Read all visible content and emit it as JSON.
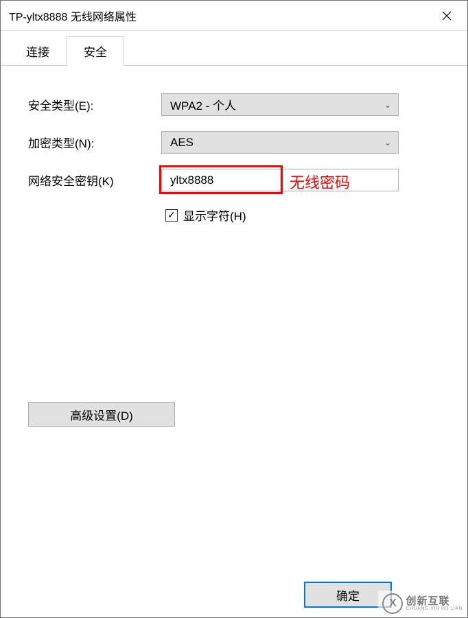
{
  "window": {
    "title": "TP-yltx8888 无线网络属性"
  },
  "tabs": {
    "connect": "连接",
    "security": "安全"
  },
  "form": {
    "security_type_label": "安全类型(E):",
    "security_type_value": "WPA2 - 个人",
    "encryption_type_label": "加密类型(N):",
    "encryption_type_value": "AES",
    "network_key_label": "网络安全密钥(K)",
    "network_key_value": "yltx8888",
    "show_characters_label": "显示字符(H)",
    "show_characters_checked": "✓"
  },
  "annotation": {
    "label": "无线密码"
  },
  "buttons": {
    "advanced": "高级设置(D)",
    "ok": "确定"
  },
  "watermark": {
    "icon_text": "X",
    "cn": "创新互联",
    "en": "CHUANG XIN HU LIAN"
  }
}
